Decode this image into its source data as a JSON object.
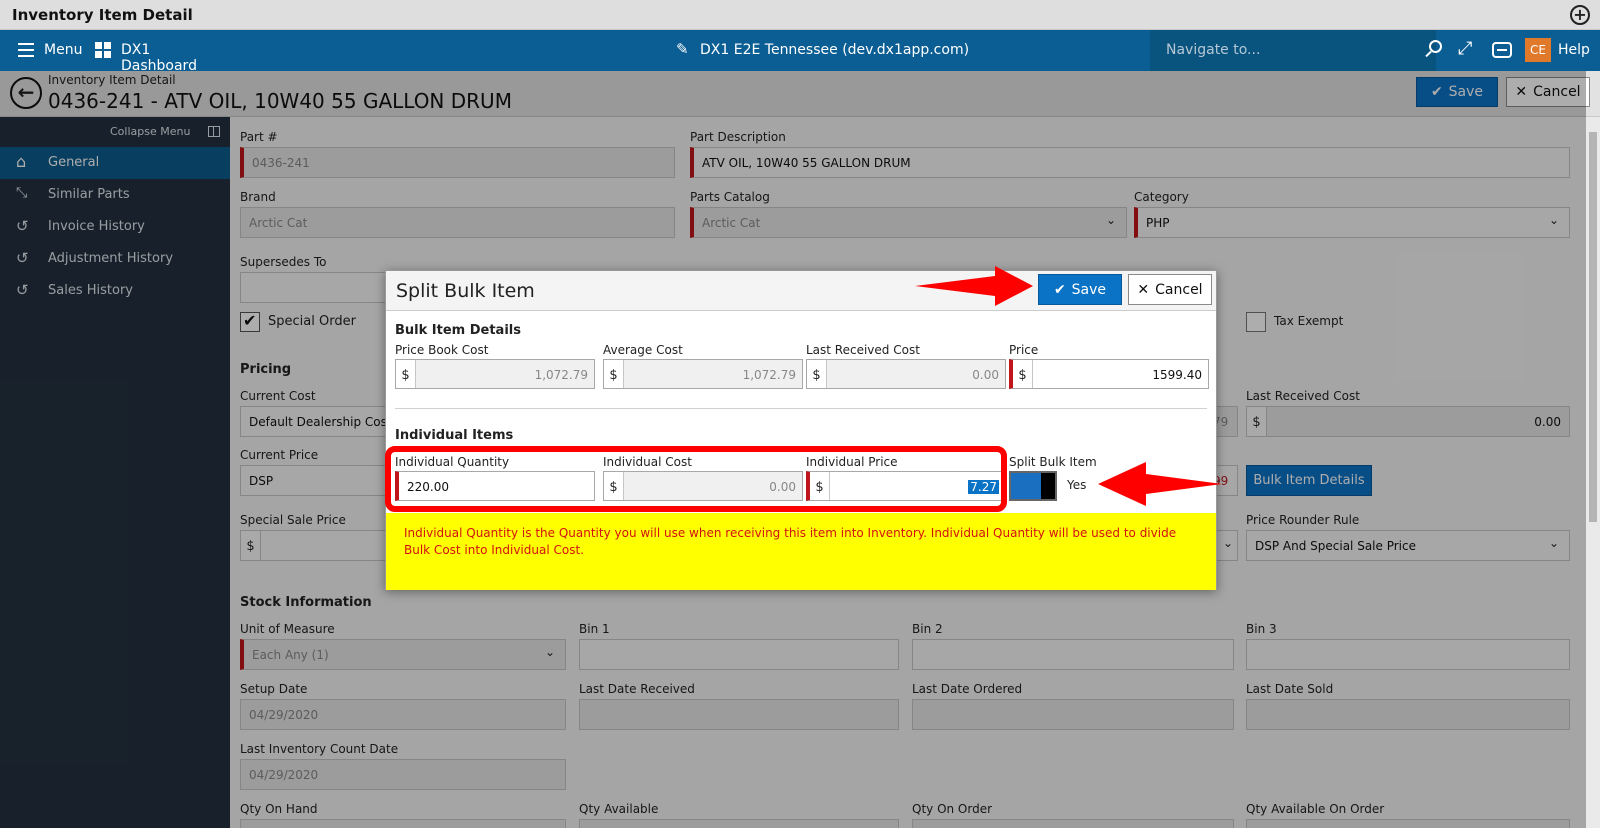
{
  "window": {
    "title": "Inventory Item Detail"
  },
  "topnav": {
    "menu_label": "Menu",
    "dashboard_label": "DX1 Dashboard",
    "site_label": "DX1 E2E Tennessee (dev.dx1app.com)",
    "search_placeholder": "Navigate to...",
    "avatar_initials": "CE",
    "help_label": "Help",
    "bar_color": "#0b5e94",
    "avatar_color": "#e07a2a"
  },
  "header": {
    "breadcrumb": "Inventory Item Detail",
    "title": "0436-241 - ATV OIL, 10W40 55 GALLON DRUM",
    "save_label": "Save",
    "cancel_label": "Cancel"
  },
  "sidebar": {
    "collapse_label": "Collapse Menu",
    "items": [
      {
        "label": "General",
        "icon": "home-icon",
        "active": true
      },
      {
        "label": "Similar Parts",
        "icon": "compress-arrows-icon"
      },
      {
        "label": "Invoice History",
        "icon": "history-icon"
      },
      {
        "label": "Adjustment History",
        "icon": "history-icon"
      },
      {
        "label": "Sales History",
        "icon": "history-icon"
      }
    ]
  },
  "form": {
    "part_no_label": "Part #",
    "part_no_value": "0436-241",
    "part_desc_label": "Part Description",
    "part_desc_value": "ATV OIL, 10W40  55 GALLON DRUM",
    "brand_label": "Brand",
    "brand_value": "Arctic Cat",
    "catalog_label": "Parts Catalog",
    "catalog_value": "Arctic Cat",
    "category_label": "Category",
    "category_value": "PHP",
    "supersedes_label": "Supersedes To",
    "special_order_label": "Special Order",
    "tax_exempt_label": "Tax Exempt",
    "pricing_header": "Pricing",
    "current_cost_label": "Current Cost",
    "current_cost_value": "Default Dealership Cost",
    "current_price_label": "Current Price",
    "current_price_value": "DSP",
    "special_sale_label": "Special Sale Price",
    "last_received_cost_label": "Last Received Cost",
    "last_received_cost_value": "0.00",
    "partial_cost_left": "79",
    "partial_price_left": "99",
    "bulk_details_button": "Bulk Item Details",
    "price_rounder_label": "Price Rounder Rule",
    "price_rounder_value": "DSP And Special Sale Price",
    "stock_header": "Stock Information",
    "uom_label": "Unit of Measure",
    "uom_value": "Each Any (1)",
    "bin1_label": "Bin 1",
    "bin2_label": "Bin 2",
    "bin3_label": "Bin 3",
    "setup_date_label": "Setup Date",
    "setup_date_value": "04/29/2020",
    "last_received_label": "Last Date Received",
    "last_ordered_label": "Last Date Ordered",
    "last_sold_label": "Last Date Sold",
    "last_count_label": "Last Inventory Count Date",
    "last_count_value": "04/29/2020",
    "qty_on_hand_label": "Qty On Hand",
    "qty_available_label": "Qty Available",
    "qty_on_order_label": "Qty On Order",
    "qty_avail_on_order_label": "Qty Available On Order"
  },
  "modal": {
    "title": "Split Bulk Item",
    "save_label": "Save",
    "cancel_label": "Cancel",
    "bulk_header": "Bulk Item Details",
    "price_book_cost_label": "Price Book Cost",
    "price_book_cost_value": "1,072.79",
    "average_cost_label": "Average Cost",
    "average_cost_value": "1,072.79",
    "last_received_cost_label": "Last Received Cost",
    "last_received_cost_value": "0.00",
    "price_label": "Price",
    "price_value": "1599.40",
    "individual_header": "Individual Items",
    "ind_qty_label": "Individual Quantity",
    "ind_qty_value": "220.00",
    "ind_cost_label": "Individual Cost",
    "ind_cost_value": "0.00",
    "ind_price_label": "Individual Price",
    "ind_price_value": "7.27",
    "split_label": "Split Bulk Item",
    "split_state": "Yes",
    "currency_symbol": "$",
    "note": "Individual Quantity is the Quantity you will use when receiving this item into Inventory. Individual Quantity will be used to divide Bulk Cost into Individual Cost.",
    "note_bg": "#ffff00",
    "note_color": "#d31212"
  },
  "annotations": {
    "highlight_color": "#ff0000"
  }
}
